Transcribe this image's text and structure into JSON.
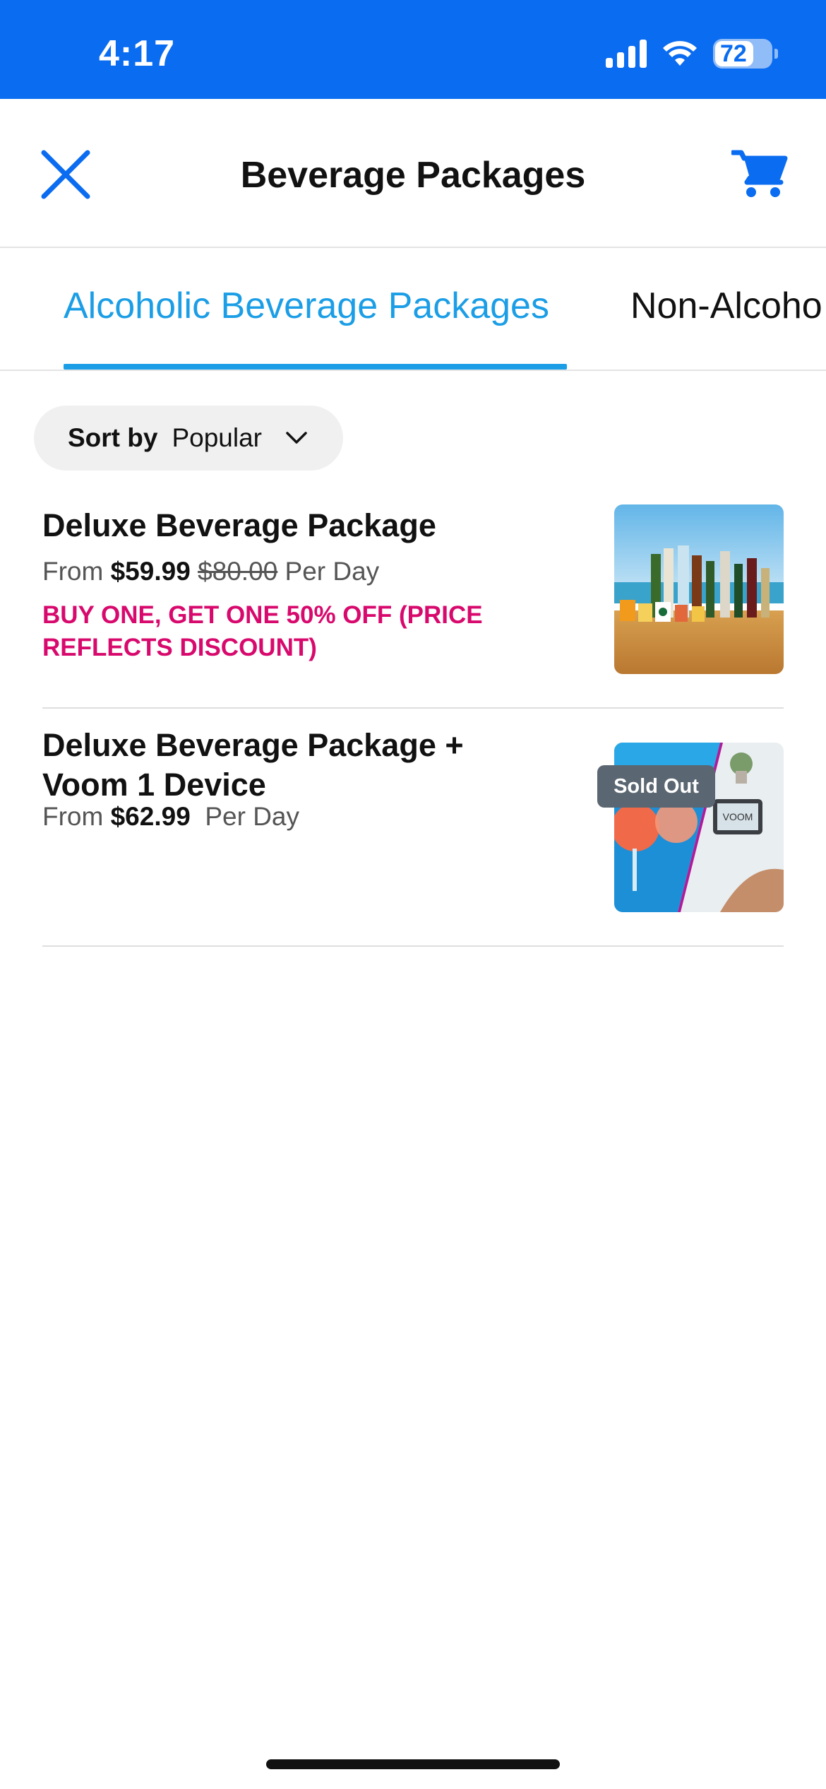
{
  "status_bar": {
    "time": "4:17",
    "battery": "72",
    "battery_level_percent": 72,
    "background_color": "#0a6cf0"
  },
  "header": {
    "title": "Beverage Packages",
    "close_icon": "close-icon",
    "cart_icon": "cart-icon",
    "accent_color": "#0a6cf0"
  },
  "tabs": [
    {
      "label": "Alcoholic Beverage Packages",
      "active": true
    },
    {
      "label": "Non-Alcoho",
      "active": false
    }
  ],
  "tab_active_color": "#1b9ee6",
  "sort": {
    "label": "Sort by",
    "value": "Popular",
    "icon": "chevron-down-icon"
  },
  "packages": [
    {
      "name": "Deluxe Beverage Package",
      "from_label": "From",
      "price": "$59.99",
      "original_price": "$80.00",
      "per_day": "Per Day",
      "promo": "BUY ONE, GET ONE 50% OFF (PRICE REFLECTS DISCOUNT)",
      "image": "beach-bar-drinks-image"
    },
    {
      "name": "Deluxe Beverage Package + Voom 1 Device",
      "from_label": "From",
      "price": "$62.99",
      "per_day": "Per Day",
      "badge": "Sold Out",
      "image": "cocktails-and-voom-tablet-image",
      "image_text": "VOOM"
    }
  ],
  "promo_color": "#d8096d"
}
